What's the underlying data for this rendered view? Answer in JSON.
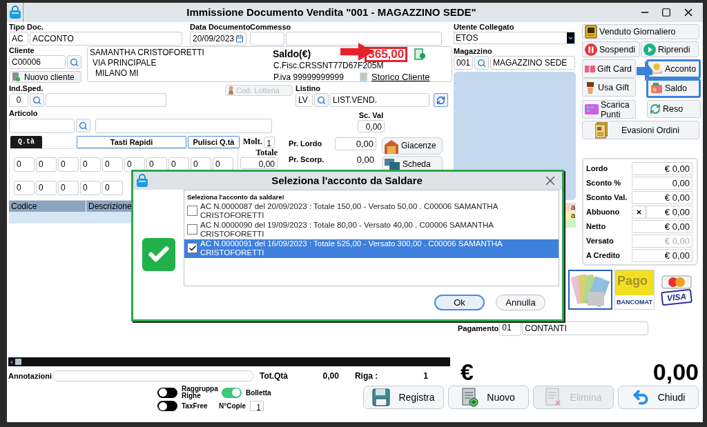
{
  "window": {
    "title": "Immissione Documento Vendita \"001 - MAGAZZINO SEDE\""
  },
  "document": {
    "tipo_label": "Tipo Doc.",
    "tipo_code": "AC",
    "tipo_name": "ACCONTO",
    "data_label": "Data Documento",
    "data": "20/09/2023",
    "commesso_label": "Commesso"
  },
  "cliente": {
    "label": "Cliente",
    "code": "C00006",
    "new_button": "Nuovo cliente",
    "name": "SAMANTHA CRISTOFORETTI",
    "address": "VIA PRINCIPALE",
    "city": "MILANO MI",
    "saldo_label": "Saldo(€)",
    "saldo": "365,00",
    "cf": "C.Fisc.CRSSNT77D67F205M",
    "piva": "P.iva 99999999999",
    "history_link": "Storico Cliente"
  },
  "lottery_button": {
    "label": "Cod. Lotteria",
    "disabled": true
  },
  "ind_sped": {
    "label": "Ind.Sped.",
    "code": "0"
  },
  "listino": {
    "label": "Listino",
    "code": "LV",
    "name": "LIST.VEND."
  },
  "articolo": {
    "label": "Articolo"
  },
  "sc_val": {
    "label": "Sc. Val",
    "value": "0,00"
  },
  "qty_tabs": [
    {
      "label": "Q.tà",
      "selected": true
    }
  ],
  "qty_buttons": [
    "Tasti Rapidi",
    "Pulisci Q.tà"
  ],
  "molt": {
    "label": "Molt.",
    "value": "1"
  },
  "totale": {
    "label": "Totale",
    "value": "0,00"
  },
  "qty_grid": [
    [
      "0",
      "0",
      "0",
      "0",
      "0",
      "0",
      "0",
      "0",
      "0",
      "0"
    ],
    [
      "0",
      "0",
      "0",
      "0",
      "0"
    ]
  ],
  "prices": [
    {
      "label": "Pr. Lordo",
      "value": "0,00",
      "kind": "field"
    },
    {
      "label": "Pr. Scorp.",
      "value": "0,00",
      "kind": "plain"
    }
  ],
  "side_buttons": [
    {
      "label": "Giacenze",
      "kind": "warehouse"
    },
    {
      "label": "Scheda",
      "kind": "card"
    }
  ],
  "table": {
    "columns": [
      "Codice",
      "Descrizione"
    ]
  },
  "legend": [
    {
      "text": "a",
      "color": "#f8d4c8"
    },
    {
      "text": "a",
      "color": "#f4f0a8"
    },
    {
      "color": "#ccf6c4"
    }
  ],
  "footer": {
    "annotazioni_label": "Annotazioni",
    "tot_qta_label": "Tot.Qtà",
    "tot_qta": "0,00",
    "riga_label": "Riga :",
    "riga": "1"
  },
  "toggles": [
    {
      "label": "Raggruppa Righe",
      "on": false
    },
    {
      "label": "Bolletta",
      "on": true
    },
    {
      "label": "TaxFree",
      "on": false
    }
  ],
  "copies": {
    "label": "N°Copie",
    "value": "1"
  },
  "utente": {
    "label": "Utente Collegato",
    "value": "ETOS"
  },
  "magazzino": {
    "label": "Magazzino",
    "code": "001",
    "name": "MAGAZZINO SEDE"
  },
  "actions": [
    {
      "label": "Venduto Giornaliero",
      "kind": "report",
      "highlighted": false
    },
    {
      "label": "Sospendi",
      "kind": "pause",
      "highlighted": false
    },
    {
      "label": "Riprendi",
      "kind": "play",
      "highlighted": false
    },
    {
      "label": "Gift Card",
      "kind": "giftcard",
      "highlighted": false
    },
    {
      "label": "Usa Gift",
      "kind": "gift",
      "highlighted": false
    },
    {
      "label": "Acconto",
      "kind": "coins",
      "highlighted": true
    },
    {
      "label": "Saldo",
      "kind": "wallet",
      "highlighted": true
    },
    {
      "label": "Scarica Punti",
      "kind": "points",
      "highlighted": false
    },
    {
      "label": "Reso",
      "kind": "refresh",
      "highlighted": false
    },
    {
      "label": "Evasioni Ordini",
      "kind": "orders",
      "highlighted": false
    }
  ],
  "totals": [
    {
      "label": "Lordo",
      "value": "€ 0,00",
      "kind": "plain",
      "disabled": false
    },
    {
      "label": "Sconto %",
      "value": "0,00",
      "kind": "plain",
      "disabled": false
    },
    {
      "label": "Sconto Val.",
      "value": "€ 0,00",
      "kind": "plain",
      "disabled": false
    },
    {
      "label": "Abbuono",
      "value": "€ 0,00",
      "kind": "clearable",
      "disabled": false
    },
    {
      "label": "Netto",
      "value": "€ 0,00",
      "kind": "plain",
      "disabled": false
    },
    {
      "label": "Versato",
      "value": "€ 0,00",
      "kind": "plain",
      "disabled": true
    },
    {
      "label": "A Credito",
      "value": "€ 0,00",
      "kind": "plain",
      "disabled": false
    }
  ],
  "payment_methods": [
    {
      "kind": "cash",
      "selected": true
    },
    {
      "kind": "bancomat",
      "selected": false,
      "texts": [
        "Pago",
        "BANCOMAT"
      ]
    },
    {
      "kind": "cards",
      "selected": false,
      "texts": [
        "VISA"
      ]
    }
  ],
  "pagamento": {
    "label": "Pagamento",
    "code": "01",
    "name": "CONTANTI"
  },
  "total": {
    "currency": "€",
    "amount": "0,00"
  },
  "bottom_buttons": [
    {
      "label": "Registra",
      "kind": "save",
      "disabled": false
    },
    {
      "label": "Nuovo",
      "kind": "new",
      "disabled": false
    },
    {
      "label": "Elimina",
      "kind": "delete",
      "disabled": true
    },
    {
      "label": "Chiudi",
      "kind": "close",
      "disabled": false
    }
  ],
  "dialog": {
    "title": "Seleziona l'acconto da Saldare",
    "prompt": "Seleziona l'acconto da saldare!",
    "items": [
      {
        "text": "AC N.0000087 del 20/09/2023 : Totale 150,00 - Versato 50,00 .  C00006 SAMANTHA CRISTOFORETTI",
        "checked": false,
        "selected": false
      },
      {
        "text": "AC N.0000090 del 19/09/2023 : Totale 80,00 - Versato 40,00 .  C00006 SAMANTHA CRISTOFORETTI",
        "checked": false,
        "selected": false
      },
      {
        "text": "AC N.0000091 del 16/09/2023 : Totale 525,00 - Versato 300,00 .  C00006 SAMANTHA CRISTOFORETTI",
        "checked": true,
        "selected": true
      }
    ],
    "buttons": [
      "Ok",
      "Annulla"
    ]
  }
}
